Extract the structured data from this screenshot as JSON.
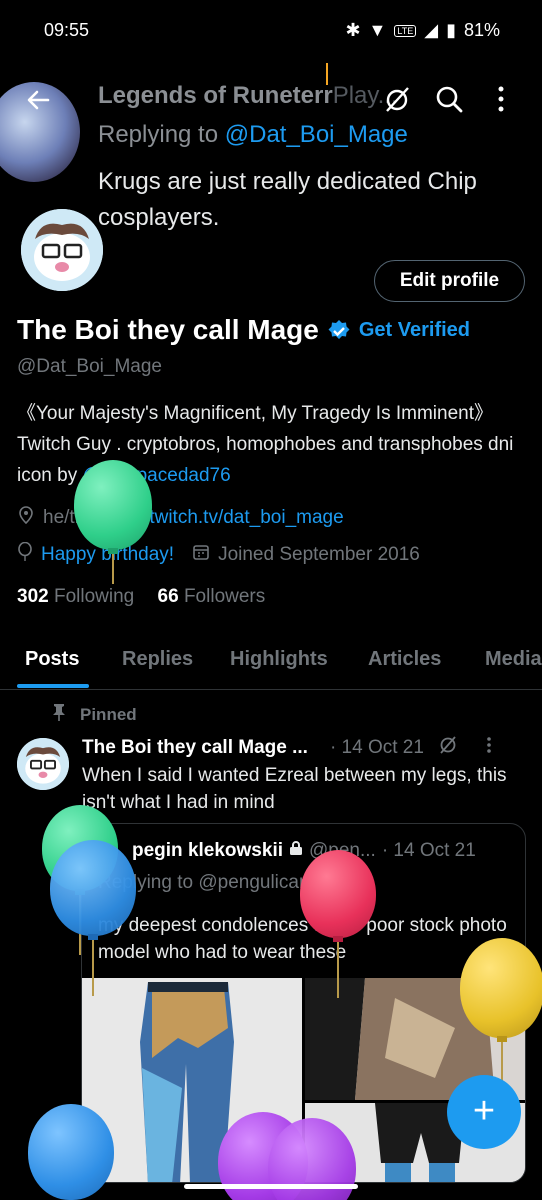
{
  "status_bar": {
    "time": "09:55",
    "battery": "81%",
    "network": "LTE"
  },
  "background_tweet": {
    "author": "Legends of Runeterr",
    "author_tail": "Play",
    "replying_prefix": "Replying to ",
    "replying_handle": "@Dat_Boi_Mage",
    "text": "Krugs are just really dedicated Chip cosplayers."
  },
  "profile": {
    "edit_label": "Edit profile",
    "name": "The Boi they call Mage",
    "get_verified": "Get Verified",
    "handle": "@Dat_Boi_Mage",
    "bio_text": "《Your Majesty's Magnificent, My Tragedy Is Imminent》 Twitch Guy  . cryptobros, homophobes and transphobes dni  icon by ",
    "bio_link": "@sgtspacedad76",
    "pronouns": "he/they",
    "website": "twitch.tv/dat_boi_mage",
    "birthday": "Happy birthday!",
    "joined": "Joined September 2016",
    "following_count": "302",
    "following_label": "Following",
    "followers_count": "66",
    "followers_label": "Followers"
  },
  "tabs": [
    "Posts",
    "Replies",
    "Highlights",
    "Articles",
    "Media"
  ],
  "pinned_post": {
    "pinned_label": "Pinned",
    "author": "The Boi they call Mage ...",
    "date": "· 14 Oct 21",
    "text": "When I said I wanted Ezreal between my legs, this isn't what I had in mind",
    "quote": {
      "author": "pegin klekowskii",
      "handle": "@pen...",
      "date": "· 14 Oct 21",
      "replying": "Replying to @pengulican",
      "text": "my deepest condolences to the poor stock photo model who had to wear these"
    }
  },
  "fab_label": "+",
  "colors": {
    "accent": "#1d9bf0",
    "background": "#000000",
    "muted": "#71767b"
  }
}
